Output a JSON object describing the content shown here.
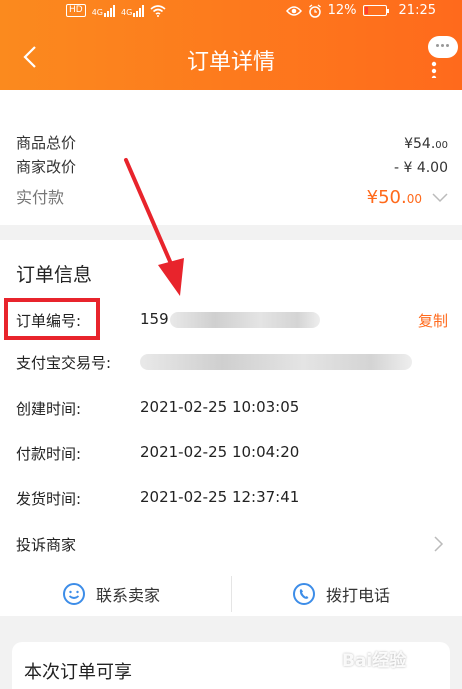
{
  "status_bar": {
    "network_badge": "HD",
    "signal_label_1": "4G",
    "signal_label_2": "4G",
    "battery_percent": "12%",
    "time": "21:25",
    "icons": [
      "eye-icon",
      "alarm-icon",
      "wifi-icon",
      "battery-icon"
    ]
  },
  "header": {
    "title": "订单详情",
    "back_icon": "chevron-left-icon",
    "more_icon": "more-vertical-icon",
    "message_icon": "chat-bubble-icon"
  },
  "price": {
    "goods_total_label": "商品总价",
    "goods_total_value_main": "¥54.",
    "goods_total_value_dec": "00",
    "seller_adjust_label": "商家改价",
    "seller_adjust_value": "- ¥ 4.00",
    "paid_label": "实付款",
    "paid_value_main": "¥50.",
    "paid_value_dec": "00"
  },
  "order_info": {
    "title": "订单信息",
    "order_no_label": "订单编号:",
    "order_no_value": "159",
    "copy_label": "复制",
    "alipay_label": "支付宝交易号:",
    "created_label": "创建时间:",
    "created_value": "2021-02-25 10:03:05",
    "paid_label": "付款时间:",
    "paid_value": "2021-02-25 10:04:20",
    "shipped_label": "发货时间:",
    "shipped_value": "2021-02-25 12:37:41",
    "complain_label": "投诉商家"
  },
  "actions": {
    "contact_seller": "联系卖家",
    "call_phone": "拨打电话"
  },
  "benefits": {
    "title": "本次订单可享"
  },
  "watermark": "Bai经验",
  "colors": {
    "accent": "#ff6a1c",
    "highlight_box": "#e8242c",
    "arrow": "#e8242c",
    "contact_icon": "#3d8de8"
  }
}
